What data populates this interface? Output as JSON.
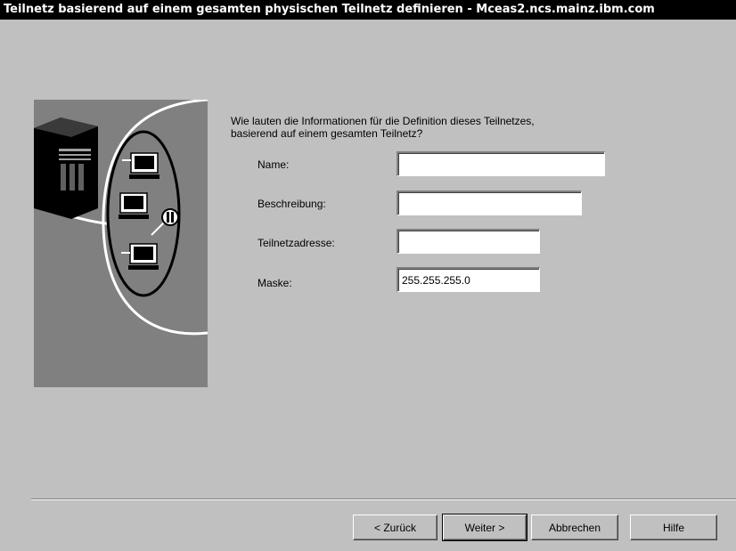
{
  "window": {
    "title": "Teilnetz basierend auf einem gesamten physischen Teilnetz definieren - Mceas2.ncs.mainz.ibm.com"
  },
  "illustration": {
    "icons": [
      "server-icon",
      "computer-icon",
      "computer-icon",
      "computer-icon",
      "connector-icon"
    ]
  },
  "prompt": {
    "line1": "Wie lauten die Informationen für die Definition dieses Teilnetzes,",
    "line2": "basierend auf einem gesamten Teilnetz?"
  },
  "form": {
    "name_label": "Name:",
    "name_value": "",
    "description_label": "Beschreibung:",
    "description_value": "",
    "subnet_label": "Teilnetzadresse:",
    "subnet_value": "",
    "mask_label": "Maske:",
    "mask_value": "255.255.255.0"
  },
  "buttons": {
    "back": "< Zurück",
    "next": "Weiter >",
    "cancel": "Abbrechen",
    "help": "Hilfe"
  },
  "colors": {
    "title_bar": "#000000",
    "dialog_face": "#c0c0c0",
    "illustration_bg": "#808080"
  }
}
